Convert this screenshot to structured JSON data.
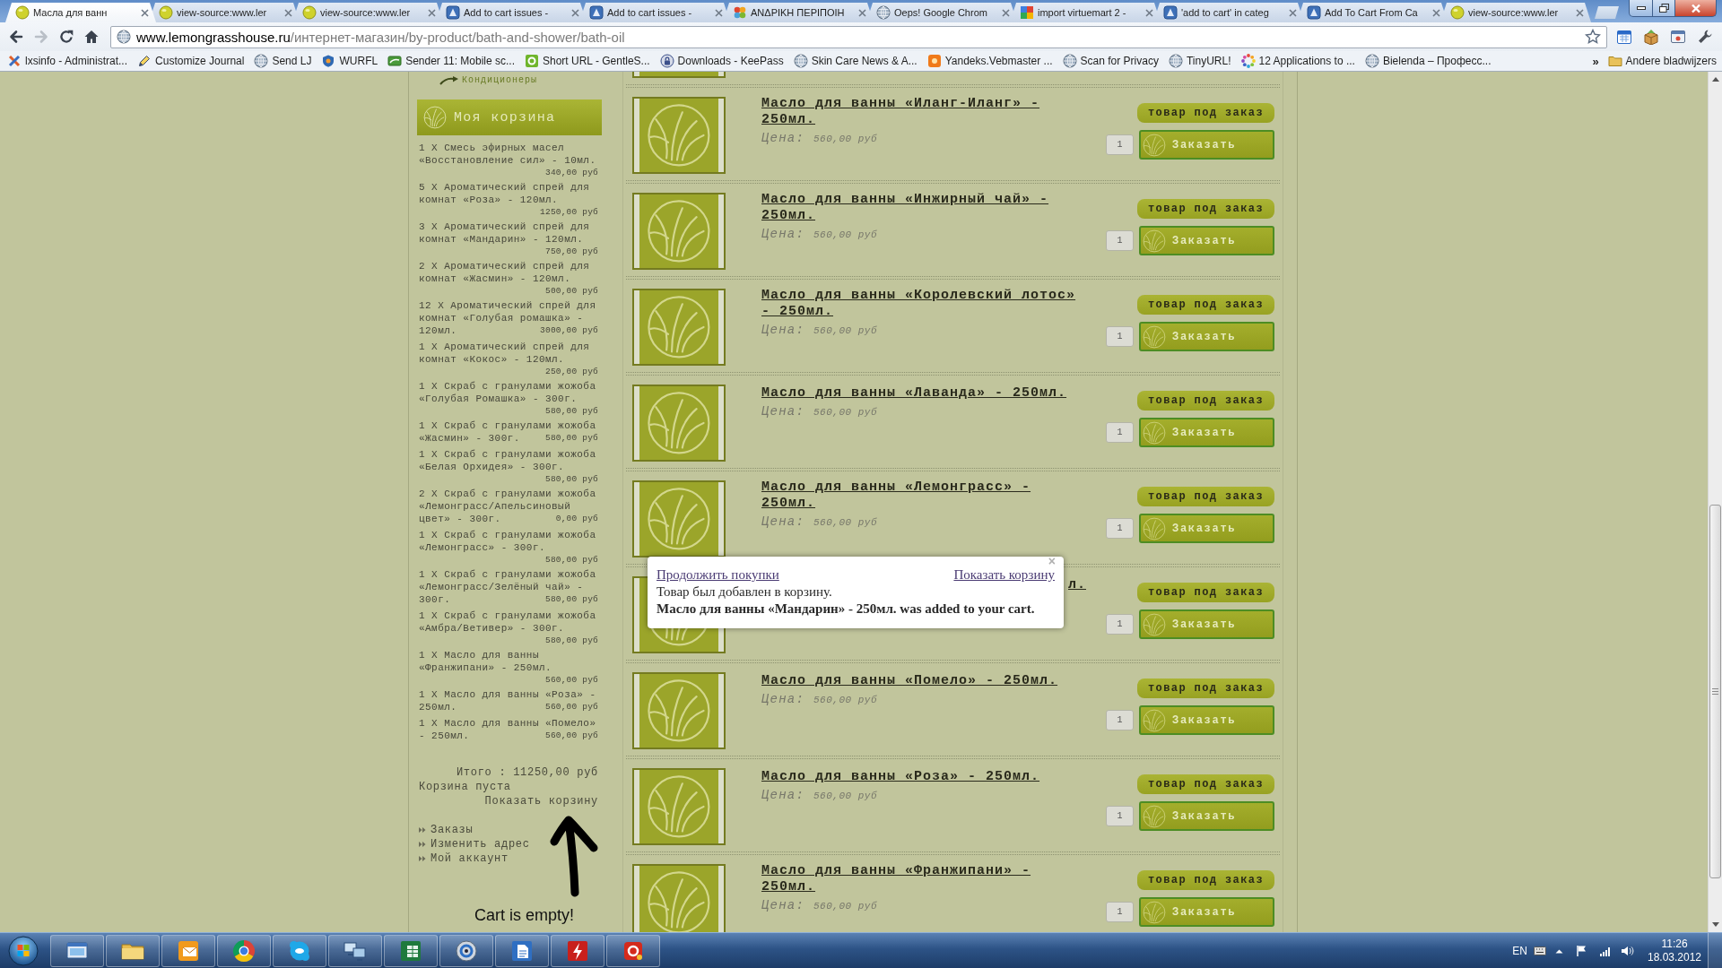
{
  "browser": {
    "tabs": [
      {
        "title": "Масла для ванн",
        "selected": true
      },
      {
        "title": "view-source:www.ler",
        "selected": false
      },
      {
        "title": "view-source:www.ler",
        "selected": false
      },
      {
        "title": "Add to cart issues -",
        "selected": false
      },
      {
        "title": "Add to cart issues -",
        "selected": false
      },
      {
        "title": "ΑΝΔΡΙΚΗ ΠΕΡΙΠΟΙΗ",
        "selected": false
      },
      {
        "title": "Oeps! Google Chrom",
        "selected": false
      },
      {
        "title": "import virtuemart 2 -",
        "selected": false
      },
      {
        "title": "'add to cart' in categ",
        "selected": false
      },
      {
        "title": "Add To Cart From Ca",
        "selected": false
      },
      {
        "title": "view-source:www.ler",
        "selected": false
      }
    ],
    "navigation": [
      {
        "kind": "back",
        "disabled": false
      },
      {
        "kind": "forward",
        "disabled": true
      },
      {
        "kind": "reload",
        "disabled": false
      },
      {
        "kind": "home",
        "disabled": false
      }
    ],
    "address": {
      "domain": "www.lemongrasshouse.ru",
      "path": "/интернет-магазин/by-product/bath-and-shower/bath-oil"
    },
    "bookmarks": [
      "lxsinfo - Administrat...",
      "Customize Journal",
      "Send LJ",
      "WURFL",
      "Sender 11: Mobile sc...",
      "Short URL - GentleS...",
      "Downloads - KeePass",
      "Skin Care News & A...",
      "Yandeks.Vebmaster ...",
      "Scan for Privacy",
      "TinyURL!",
      "12 Applications to ...",
      "Bielenda – Професс..."
    ],
    "bookmarks_overflow": "»",
    "other_bookmarks": "Andere bladwijzers"
  },
  "sidebar": {
    "category_link": "Кондиционеры",
    "cart": {
      "title": "Моя корзина",
      "items": [
        {
          "name": "1 X Смесь эфирных масел «Восстановление сил» - 10мл.",
          "price": "340,00 руб"
        },
        {
          "name": "5 X Ароматический спрей для комнат «Роза» - 120мл.",
          "price": "1250,00 руб"
        },
        {
          "name": "3 X Ароматический спрей для комнат «Мандарин» - 120мл.",
          "price": "750,00 руб"
        },
        {
          "name": "2 X Ароматический спрей для комнат «Жасмин» - 120мл.",
          "price": "500,00 руб"
        },
        {
          "name": "12 X Ароматический спрей для комнат «Голубая ромашка» - 120мл.",
          "price": "3000,00 руб"
        },
        {
          "name": "1 X Ароматический спрей для комнат «Кокос» - 120мл.",
          "price": "250,00 руб"
        },
        {
          "name": "1 X Скраб с гранулами жожоба «Голубая Ромашка» - 300г.",
          "price": "580,00 руб"
        },
        {
          "name": "1 X Скраб с гранулами жожоба «Жасмин» - 300г.",
          "price": "580,00 руб"
        },
        {
          "name": "1 X Скраб с гранулами жожоба «Белая Орхидея» - 300г.",
          "price": "580,00 руб"
        },
        {
          "name": "2 X Скраб с гранулами жожоба «Лемонграсс/Апельсиновый цвет» - 300г.",
          "price": "0,00 руб"
        },
        {
          "name": "1 X Скраб с гранулами жожоба «Лемонграсс» - 300г.",
          "price": "580,00 руб"
        },
        {
          "name": "1 X Скраб с гранулами жожоба «Лемонграсс/Зелёный чай» - 300г.",
          "price": "580,00 руб"
        },
        {
          "name": "1 X Скраб с гранулами жожоба «Амбра/Ветивер» - 300г.",
          "price": "580,00 руб"
        },
        {
          "name": "1 X Масло для ванны «Франжипани» - 250мл.",
          "price": "560,00 руб"
        },
        {
          "name": "1 X Масло для ванны «Роза» - 250мл.",
          "price": "560,00 руб"
        },
        {
          "name": "1 X Масло для ванны «Помело» - 250мл.",
          "price": "560,00 руб"
        }
      ],
      "total": "Итого : 11250,00 руб",
      "status": "Корзина пуста",
      "show_cart": "Показать корзину"
    },
    "links": [
      "Заказы",
      "Изменить адрес",
      "Мой аккаунт"
    ],
    "annotation": "Cart is empty!"
  },
  "products": [
    {
      "kind": "full",
      "title": "Масло для ванны «Иланг-Иланг» - 250мл.",
      "price_label": "Цена:",
      "price": "560,00 руб",
      "availability": "товар под заказ",
      "quantity": "1",
      "button": "Заказать"
    },
    {
      "kind": "full",
      "title": "Масло для ванны «Инжирный чай» - 250мл.",
      "price_label": "Цена:",
      "price": "560,00 руб",
      "availability": "товар под заказ",
      "quantity": "1",
      "button": "Заказать"
    },
    {
      "kind": "full",
      "title": "Масло для ванны «Королевский лотос» - 250мл.",
      "price_label": "Цена:",
      "price": "560,00 руб",
      "availability": "товар под заказ",
      "quantity": "1",
      "button": "Заказать"
    },
    {
      "kind": "full",
      "title": "Масло для ванны «Лаванда» - 250мл.",
      "price_label": "Цена:",
      "price": "560,00 руб",
      "availability": "товар под заказ",
      "quantity": "1",
      "button": "Заказать"
    },
    {
      "kind": "full",
      "title": "Масло для ванны «Лемонграсс» - 250мл.",
      "price_label": "Цена:",
      "price": "560,00 руб",
      "availability": "товар под заказ",
      "quantity": "1",
      "button": "Заказать"
    },
    {
      "kind": "covered",
      "title": "л.",
      "availability": "товар под заказ",
      "quantity": "1",
      "button": "Заказать"
    },
    {
      "kind": "full",
      "title": "Масло для ванны «Помело» - 250мл.",
      "price_label": "Цена:",
      "price": "560,00 руб",
      "availability": "товар под заказ",
      "quantity": "1",
      "button": "Заказать"
    },
    {
      "kind": "full",
      "title": "Масло для ванны «Роза» - 250мл.",
      "price_label": "Цена:",
      "price": "560,00 руб",
      "availability": "товар под заказ",
      "quantity": "1",
      "button": "Заказать"
    },
    {
      "kind": "full",
      "title": "Масло для ванны «Франжипани» - 250мл.",
      "price_label": "Цена:",
      "price": "560,00 руб",
      "availability": "товар под заказ",
      "quantity": "1",
      "button": "Заказать"
    }
  ],
  "popup": {
    "close": "×",
    "continue_link": "Продолжить покупки",
    "show_cart_link": "Показать корзину",
    "message": "Товар был добавлен в корзину.",
    "added": "Масло для ванны «Мандарин» - 250мл. was added to your cart."
  },
  "taskbar": {
    "language": "EN",
    "time": "11:26",
    "date": "18.03.2012"
  }
}
